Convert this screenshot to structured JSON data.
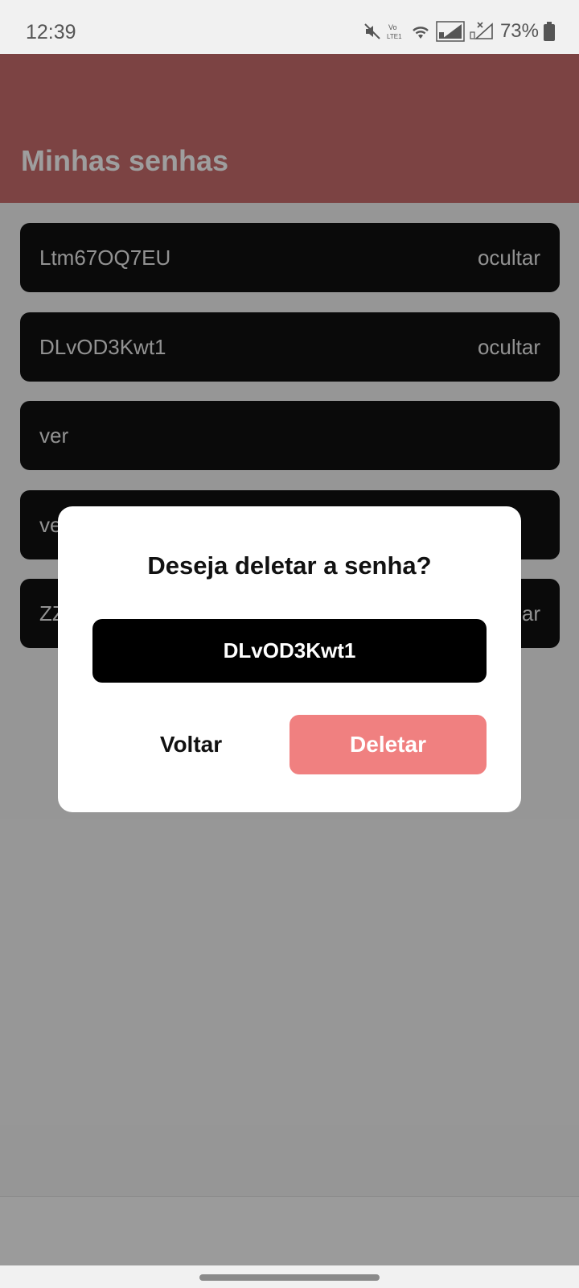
{
  "status_bar": {
    "time": "12:39",
    "battery": "73%",
    "icons": [
      "mute-icon",
      "volte-icon",
      "wifi-icon",
      "signal-icon",
      "signal-no-service-icon",
      "battery-icon"
    ]
  },
  "header": {
    "title": "Minhas senhas",
    "color": "#c96c6c"
  },
  "passwords": [
    {
      "text": "Ltm67OQ7EU",
      "action": "ocultar"
    },
    {
      "text": "DLvOD3Kwt1",
      "action": "ocultar"
    },
    {
      "text": "ver",
      "action": ""
    },
    {
      "text": "ve",
      "action": ""
    },
    {
      "text": "ZZ",
      "action": "ar"
    }
  ],
  "dialog": {
    "title": "Deseja deletar a senha?",
    "password": "DLvOD3Kwt1",
    "back_label": "Voltar",
    "delete_label": "Deletar",
    "delete_color": "#f08080"
  }
}
